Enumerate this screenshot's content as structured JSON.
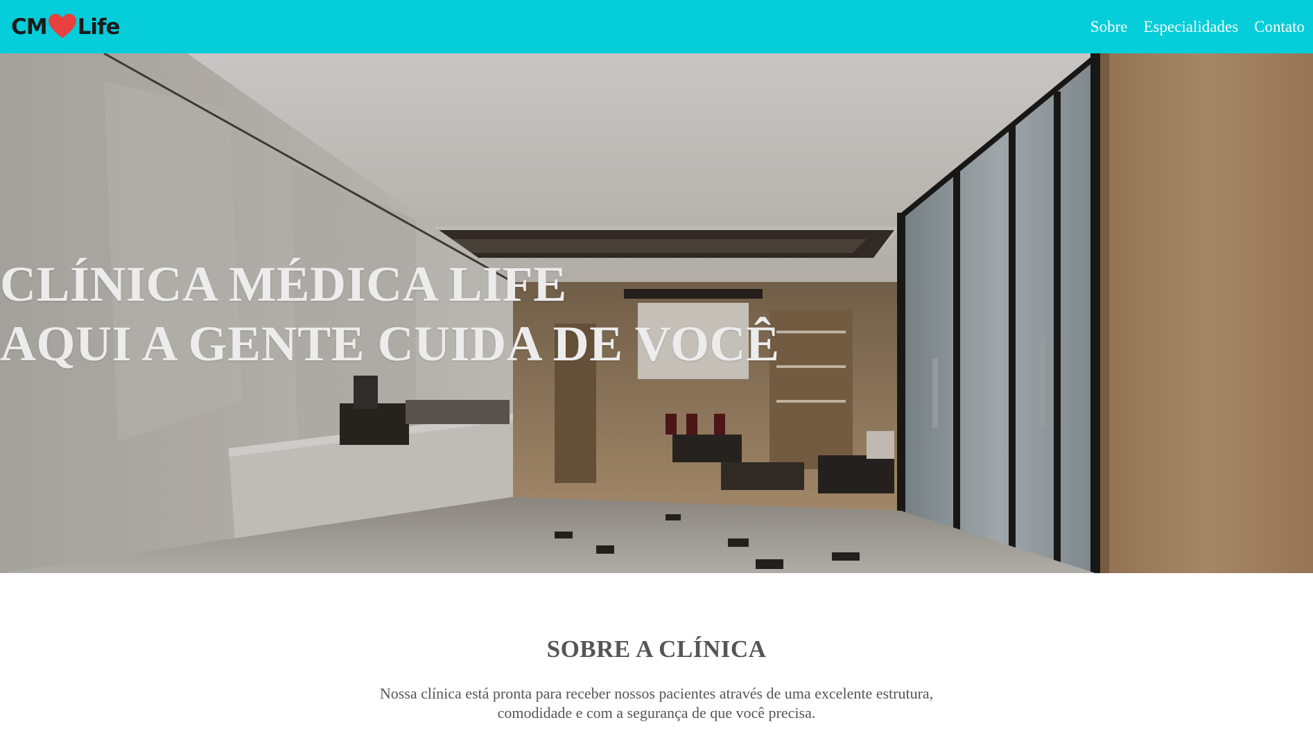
{
  "header": {
    "logo": {
      "prefix": "CM",
      "suffix": "Life",
      "icon": "heart-icon",
      "icon_color": "#e8403f"
    },
    "bg_color": "#05cdd9",
    "nav": [
      {
        "label": "Sobre"
      },
      {
        "label": "Especialidades"
      },
      {
        "label": "Contato"
      }
    ]
  },
  "hero": {
    "title_line1": "CLÍNICA MÉDICA LIFE",
    "title_line2": "AQUI A GENTE CUIDA DE VOCÊ",
    "image": "clinic-lobby-photo"
  },
  "about": {
    "heading": "SOBRE A CLÍNICA",
    "text_line1": "Nossa clínica está pronta para receber nossos pacientes através de uma excelente estrutura,",
    "text_line2": "comodidade e com a segurança de que você precisa."
  }
}
